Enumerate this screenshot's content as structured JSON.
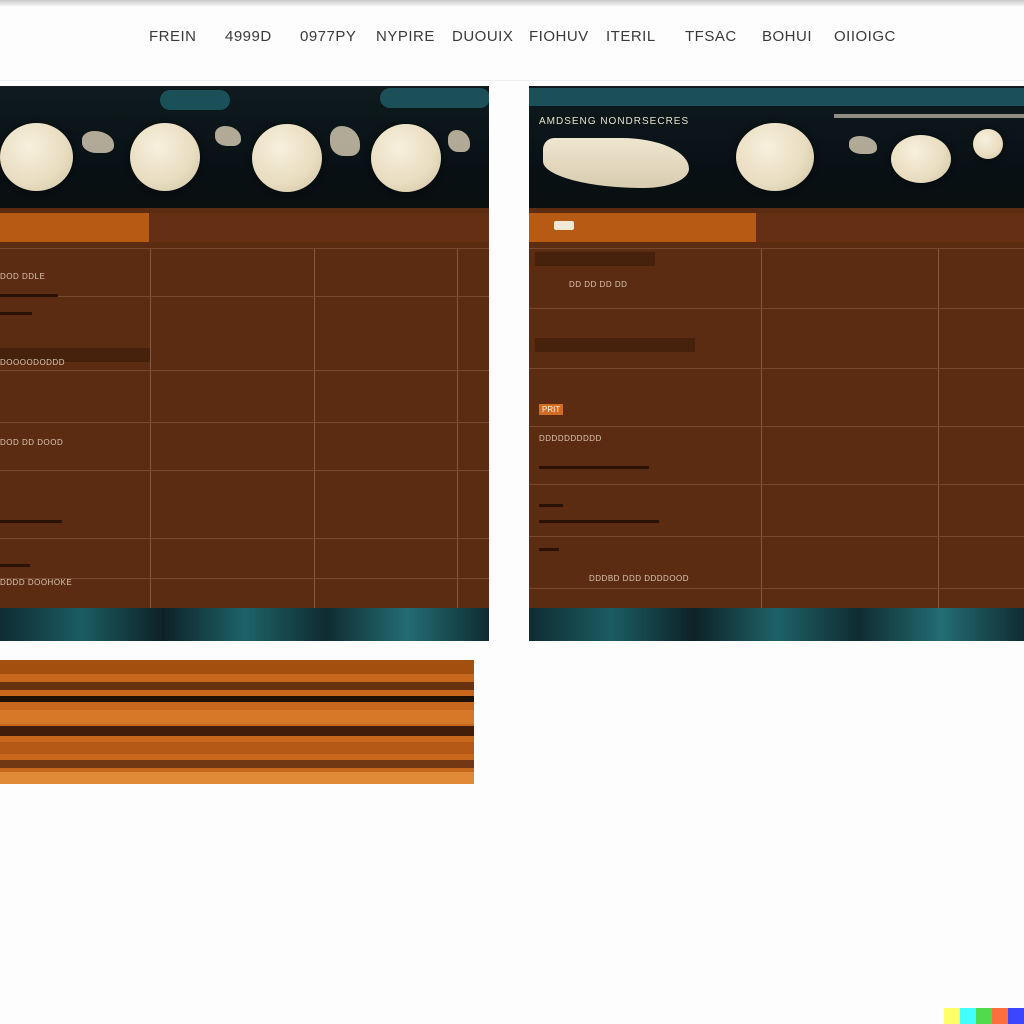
{
  "nav": {
    "items": [
      "FREIN",
      "4999D",
      "0977PY",
      "NYPIRE",
      "DUOUIX",
      "FIOHUV",
      "ITERIL",
      "TFSAC",
      "BOHUI",
      "OIIOIGC"
    ]
  },
  "left_panel": {
    "row_labels": [
      "DOD DDLE",
      "DOOOODODDD",
      "DOD DD DOOD",
      "DDDD DOOHOKE"
    ]
  },
  "right_panel": {
    "banner_caption": "AMDSENG NONDRSECRES",
    "header_label": "DD DD DD DD",
    "badge": "PRIT",
    "row_labels": [
      "DDDDDDDDDD",
      "DDDBD DDD DDDDOOD"
    ]
  },
  "colors": {
    "panel_brown": "#5b2c12",
    "accent_orange": "#b65a14",
    "teal": "#1d5a63",
    "banner_black": "#0a0f10"
  },
  "corner_mark": {
    "colors": [
      "#ffff66",
      "#42ffff",
      "#51da4c",
      "#ff6e3c",
      "#3c46ff"
    ]
  }
}
